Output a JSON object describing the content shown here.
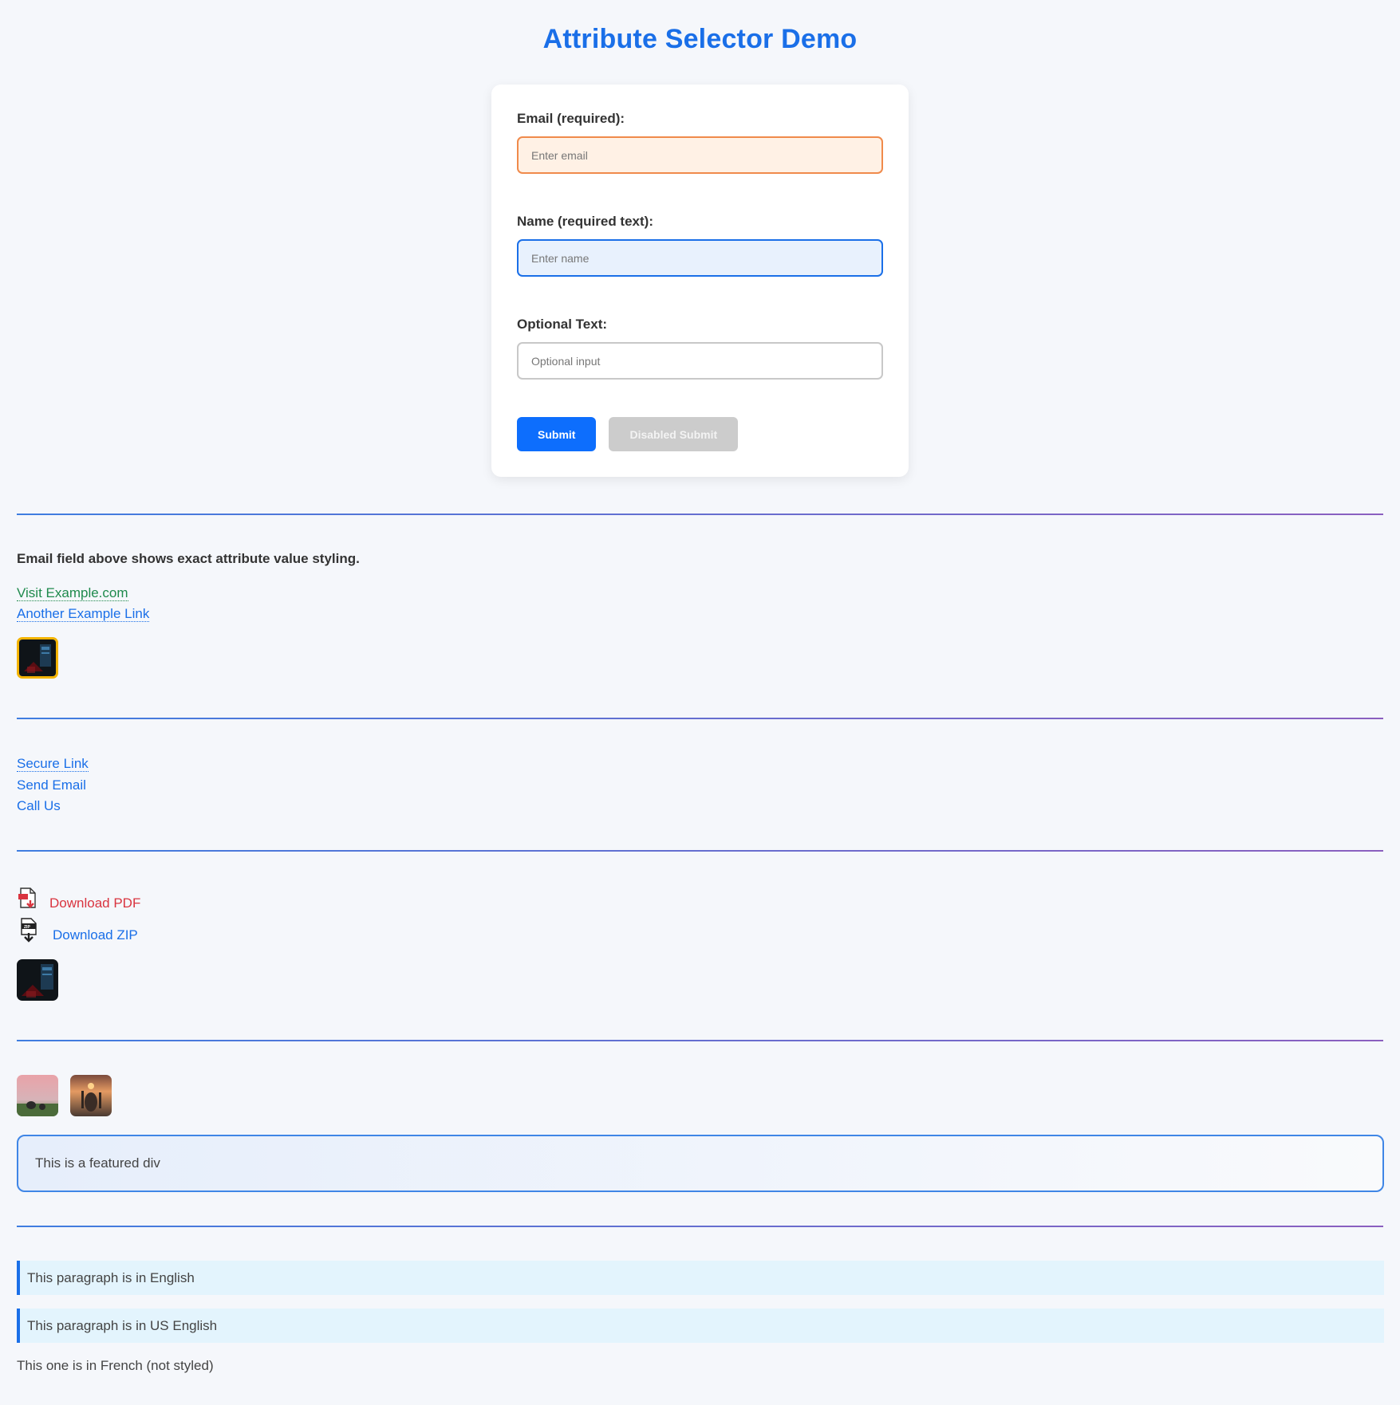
{
  "page": {
    "title": "Attribute Selector Demo"
  },
  "form": {
    "email_label": "Email (required):",
    "email_placeholder": "Enter email",
    "name_label": "Name (required text):",
    "name_placeholder": "Enter name",
    "optional_label": "Optional Text:",
    "optional_placeholder": "Optional input",
    "submit_label": "Submit",
    "disabled_submit_label": "Disabled Submit"
  },
  "section1": {
    "note": "Email field above shows exact attribute value styling.",
    "links": [
      "Visit Example.com",
      "Another Example Link"
    ]
  },
  "section2": {
    "links": [
      "Secure Link",
      "Send Email",
      "Call Us"
    ]
  },
  "section3": {
    "downloads": [
      "Download PDF",
      "Download ZIP"
    ],
    "icons": [
      "pdf-file-icon",
      "zip-file-icon"
    ]
  },
  "section4": {
    "featured_text": "This is a featured div"
  },
  "section5": {
    "paragraphs": [
      "This paragraph is in English",
      "This paragraph is in US English",
      "This one is in French (not styled)"
    ]
  },
  "colors": {
    "accent": "#1a6fe8",
    "email_border": "#f08a4b",
    "pdf_link": "#d9343f",
    "visit_link": "#1f8a4c",
    "image_highlight_border": "#f4b400"
  }
}
